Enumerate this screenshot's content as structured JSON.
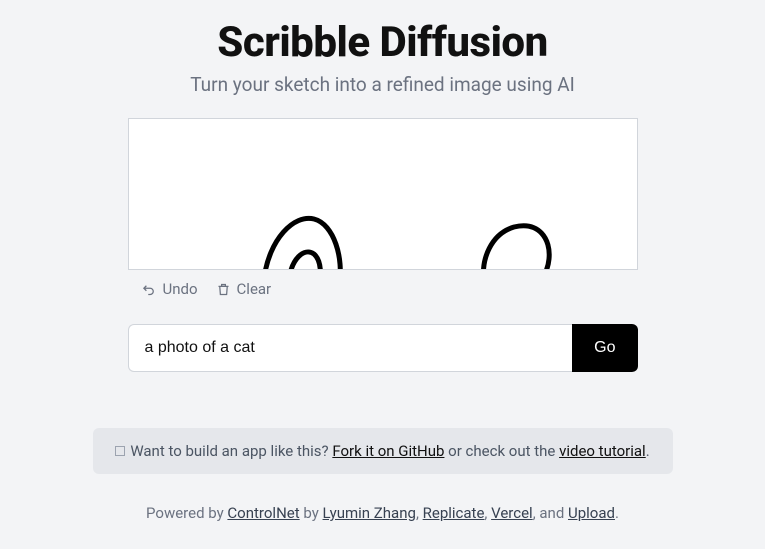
{
  "header": {
    "title": "Scribble Diffusion",
    "subtitle": "Turn your sketch into a refined image using AI"
  },
  "toolbar": {
    "undo_label": "Undo",
    "clear_label": "Clear"
  },
  "prompt": {
    "value": "a photo of a cat",
    "go_label": "Go"
  },
  "cta": {
    "prefix": "Want to build an app like this? ",
    "fork_link": "Fork it on GitHub",
    "mid": " or check out the ",
    "video_link": "video tutorial",
    "suffix": "."
  },
  "footer": {
    "prefix": "Powered by ",
    "link1": "ControlNet",
    "sep1": " by ",
    "link2": "Lyumin Zhang",
    "sep2": ", ",
    "link3": "Replicate",
    "sep3": ", ",
    "link4": "Vercel",
    "sep4": ", and ",
    "link5": "Upload",
    "suffix": "."
  }
}
